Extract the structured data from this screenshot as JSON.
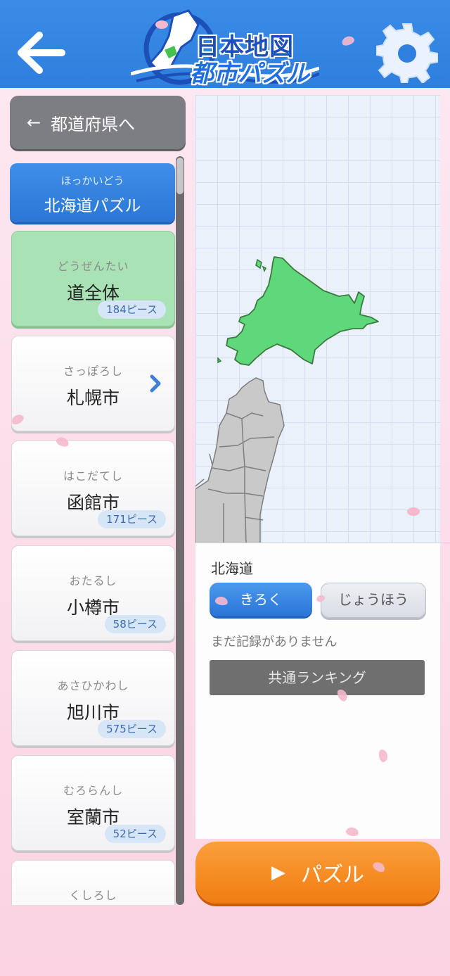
{
  "header": {
    "logo_line1": "日本地図",
    "logo_line2": "都市パズル",
    "colors": {
      "bar": "#2f7fde"
    }
  },
  "sidebar": {
    "back_label": "都道府県へ",
    "header": {
      "ruby": "ほっかいどう",
      "name": "北海道パズル"
    },
    "items": [
      {
        "ruby": "どうぜんたい",
        "name": "道全体",
        "pieces": "184ピース",
        "selected": true
      },
      {
        "ruby": "さっぽろし",
        "name": "札幌市",
        "pieces": "",
        "has_chevron": true
      },
      {
        "ruby": "はこだてし",
        "name": "函館市",
        "pieces": "171ピース"
      },
      {
        "ruby": "おたるし",
        "name": "小樽市",
        "pieces": "58ピース"
      },
      {
        "ruby": "あさひかわし",
        "name": "旭川市",
        "pieces": "575ピース"
      },
      {
        "ruby": "むろらんし",
        "name": "室蘭市",
        "pieces": "52ピース"
      },
      {
        "ruby": "くしろし",
        "name": "",
        "pieces": ""
      }
    ]
  },
  "info": {
    "title": "北海道",
    "tab_record": "きろく",
    "tab_info": "じょうほう",
    "no_record": "まだ記録がありません",
    "ranking": "共通ランキング"
  },
  "puzzle_button": {
    "label": "パズル"
  },
  "map": {
    "highlight_color": "#5fd77b",
    "base_color": "#c9c9c9"
  }
}
